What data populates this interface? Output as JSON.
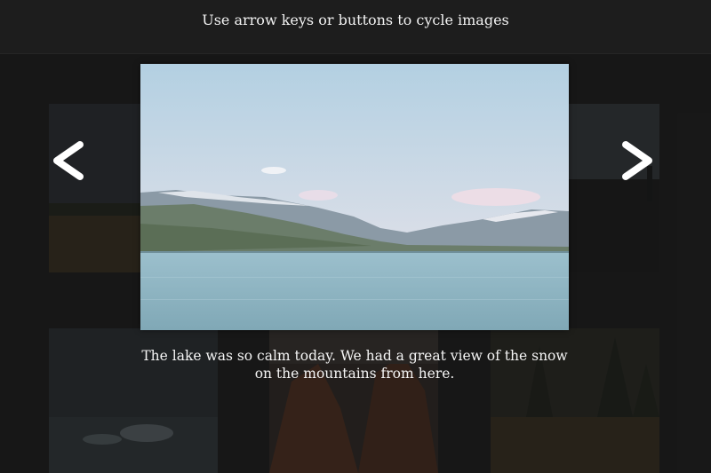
{
  "header": {
    "instructions": "Use arrow keys or buttons to cycle images"
  },
  "viewer": {
    "caption": "The lake was so calm today. We had a great view of the snow on the mountains from here.",
    "prev_icon": "chevron-left-icon",
    "next_icon": "chevron-right-icon"
  },
  "colors": {
    "background": "#1b1b1b",
    "text": "#f2f2f2",
    "arrow": "#ffffff",
    "sky": "#bcd6e6",
    "water": "#8fb6c4"
  }
}
